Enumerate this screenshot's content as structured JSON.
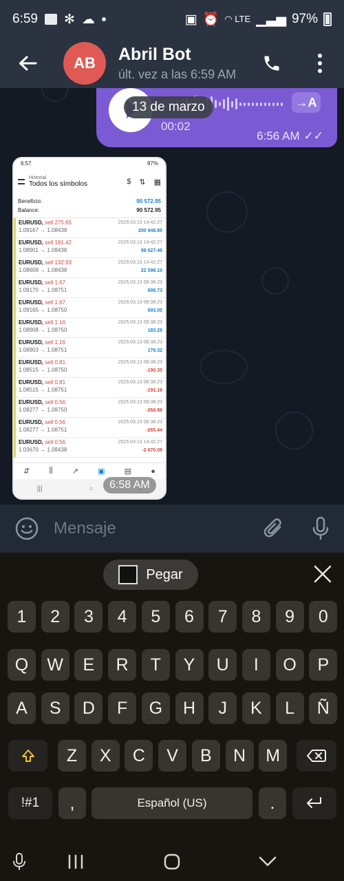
{
  "status_bar": {
    "time": "6:59",
    "battery": "97%"
  },
  "header": {
    "avatar_initials": "AB",
    "name": "Abril Bot",
    "subtitle": "últ. vez a las 6:59 AM"
  },
  "voice_message": {
    "duration": "00:02",
    "transcribe_label": "→A",
    "time": "6:56 AM"
  },
  "date_pill": "13 de marzo",
  "screenshot": {
    "status_time": "6:57",
    "status_battery": "97%",
    "header_small": "Historial",
    "header_title": "Todos los símbolos",
    "profit_label": "Beneficio:",
    "profit_value": "90 572.95",
    "balance_label": "Balance:",
    "balance_value": "90 572.95",
    "trades": [
      {
        "symbol": "EURUSD,",
        "side": "sell 275.65",
        "prices": "1.09167 → 1.08438",
        "date": "2025.03.13 14:42:27",
        "pl": "200 948.85",
        "sign": "pos"
      },
      {
        "symbol": "EURUSD,",
        "side": "sell 191.42",
        "prices": "1.08901 → 1.08438",
        "date": "2025.03.13 14:42:27",
        "pl": "88 627.46",
        "sign": "pos"
      },
      {
        "symbol": "EURUSD,",
        "side": "sell 132.93",
        "prices": "1.08608 → 1.08438",
        "date": "2025.03.13 14:42:27",
        "pl": "22 598.10",
        "sign": "pos"
      },
      {
        "symbol": "EURUSD,",
        "side": "sell 1.67",
        "prices": "1.09170 → 1.08751",
        "date": "2025.03.13 08:38:23",
        "pl": "699.73",
        "sign": "pos"
      },
      {
        "symbol": "EURUSD,",
        "side": "sell 1.67",
        "prices": "1.09165 → 1.08750",
        "date": "2025.03.13 08:38:23",
        "pl": "693.05",
        "sign": "pos"
      },
      {
        "symbol": "EURUSD,",
        "side": "sell 1.16",
        "prices": "1.08908 → 1.08750",
        "date": "2025.03.13 08:38:23",
        "pl": "183.28",
        "sign": "pos"
      },
      {
        "symbol": "EURUSD,",
        "side": "sell 1.16",
        "prices": "1.08903 → 1.08751",
        "date": "2025.03.13 08:38:23",
        "pl": "176.32",
        "sign": "pos"
      },
      {
        "symbol": "EURUSD,",
        "side": "sell 0.81",
        "prices": "1.08515 → 1.08750",
        "date": "2025.03.13 08:38:23",
        "pl": "-190.35",
        "sign": "neg"
      },
      {
        "symbol": "EURUSD,",
        "side": "sell 0.81",
        "prices": "1.08515 → 1.08751",
        "date": "2025.03.13 08:38:23",
        "pl": "-191.16",
        "sign": "neg"
      },
      {
        "symbol": "EURUSD,",
        "side": "sell 0.56",
        "prices": "1.08277 → 1.08750",
        "date": "2025.03.13 08:38:23",
        "pl": "-264.88",
        "sign": "neg"
      },
      {
        "symbol": "EURUSD,",
        "side": "sell 0.56",
        "prices": "1.08277 → 1.08751",
        "date": "2025.03.13 08:38:23",
        "pl": "-265.44",
        "sign": "neg"
      },
      {
        "symbol": "EURUSD,",
        "side": "sell 0.56",
        "prices": "1.03670 → 1.08438",
        "date": "2025.03.13 14:42:27",
        "pl": "-2 670.08",
        "sign": "neg"
      }
    ],
    "time": "6:58 AM"
  },
  "input_bar": {
    "placeholder": "Mensaje"
  },
  "keyboard": {
    "paste_label": "Pegar",
    "row_numbers": [
      "1",
      "2",
      "3",
      "4",
      "5",
      "6",
      "7",
      "8",
      "9",
      "0"
    ],
    "row_1": [
      "Q",
      "W",
      "E",
      "R",
      "T",
      "Y",
      "U",
      "I",
      "O",
      "P"
    ],
    "row_2": [
      "A",
      "S",
      "D",
      "F",
      "G",
      "H",
      "J",
      "K",
      "L",
      "Ñ"
    ],
    "row_3": [
      "Z",
      "X",
      "C",
      "V",
      "B",
      "N",
      "M"
    ],
    "symbols_label": "!#1",
    "comma_label": ",",
    "space_label": "Español (US)",
    "period_label": "."
  },
  "colors": {
    "bubble": "#7b5bd4",
    "avatar": "#e05a55",
    "header": "#2b3340",
    "keyboard": "#181510"
  }
}
